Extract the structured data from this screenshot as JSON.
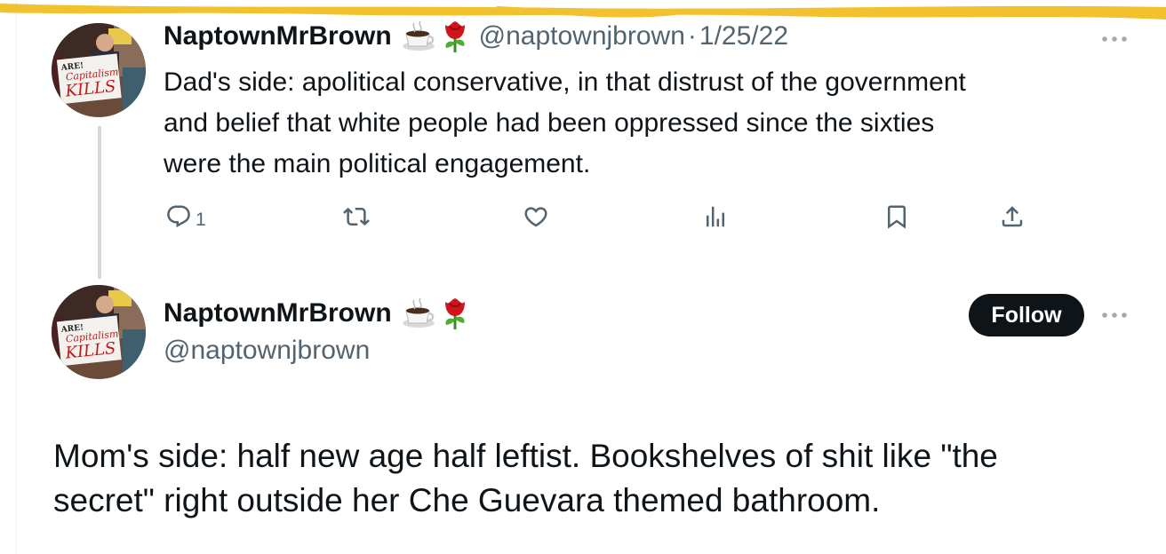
{
  "reply_tweet": {
    "display_name": "NaptownMrBrown",
    "emoji_icons": [
      "coffee-icon",
      "rose-icon"
    ],
    "handle": "@naptownjbrown",
    "separator": "·",
    "date": "1/25/22",
    "text_lines": [
      "Dad's side: apolitical conservative, in that distrust of the government",
      "and belief that white people had been oppressed since the sixties",
      "were the main political engagement."
    ],
    "actions": {
      "reply_count": "1",
      "retweet_count": "",
      "like_count": "",
      "views_count": ""
    }
  },
  "main_tweet": {
    "display_name": "NaptownMrBrown",
    "emoji_icons": [
      "coffee-icon",
      "rose-icon"
    ],
    "handle": "@naptownjbrown",
    "follow_label": "Follow",
    "text_lines": [
      "Mom's side: half new age half leftist. Bookshelves of shit like \"the",
      "secret\" right outside her Che Guevara themed bathroom."
    ]
  },
  "avatar_sign": {
    "top_word": "ARE!",
    "line1": "Capitalism",
    "line2": "KILLS"
  },
  "colors": {
    "text_primary": "#0f1419",
    "text_secondary": "#536471",
    "follow_bg": "#0f1419",
    "thread_line": "#cfd9de",
    "highlight": "#f2c12e"
  }
}
